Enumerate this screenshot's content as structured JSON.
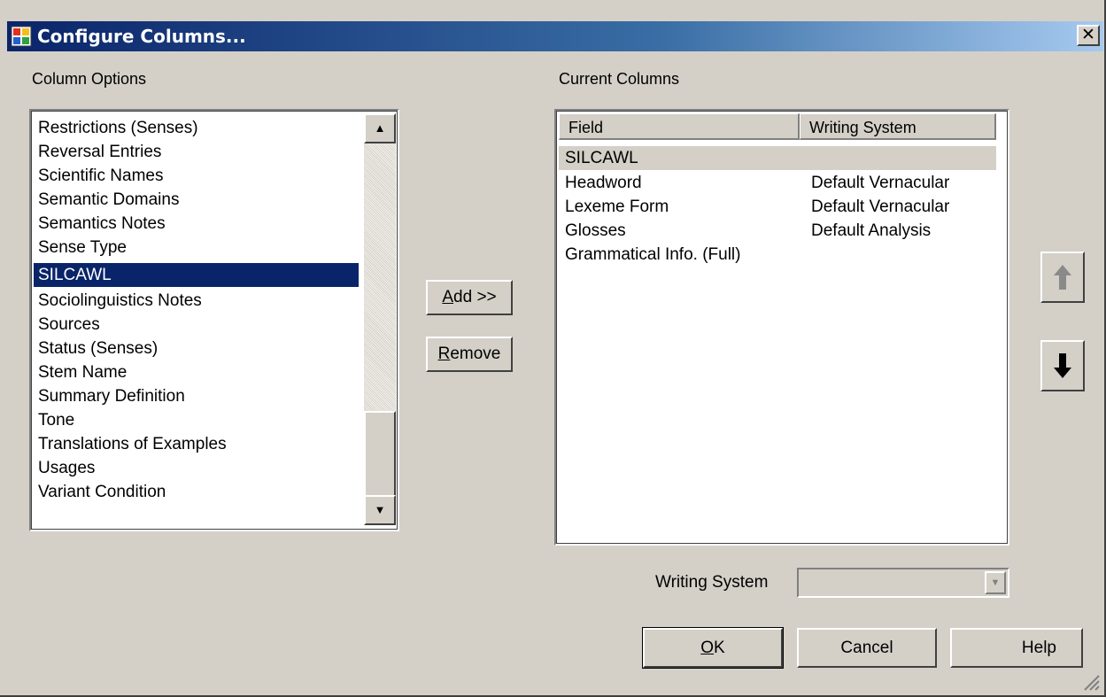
{
  "window": {
    "title": "Configure Columns...",
    "close_glyph": "✕"
  },
  "left": {
    "label": "Column Options",
    "items": [
      "Restrictions (Senses)",
      "Reversal Entries",
      "Scientific Names",
      "Semantic Domains",
      "Semantics Notes",
      "Sense Type",
      "SILCAWL",
      "Sociolinguistics Notes",
      "Sources",
      "Status (Senses)",
      "Stem Name",
      "Summary Definition",
      "Tone",
      "Translations of Examples",
      "Usages",
      "Variant Condition"
    ],
    "selected_item": "SILCAWL"
  },
  "middle": {
    "add": {
      "mnemonic": "A",
      "rest": "dd >>"
    },
    "remove": {
      "mnemonic": "R",
      "rest": "emove"
    }
  },
  "right": {
    "label": "Current Columns",
    "headers": {
      "field": "Field",
      "ws": "Writing System"
    },
    "rows": [
      {
        "field": "SILCAWL",
        "ws": ""
      },
      {
        "field": "Headword",
        "ws": "Default Vernacular"
      },
      {
        "field": "Lexeme Form",
        "ws": "Default Vernacular"
      },
      {
        "field": "Glosses",
        "ws": "Default Analysis"
      },
      {
        "field": "Grammatical Info. (Full)",
        "ws": ""
      }
    ],
    "selected_row": "SILCAWL"
  },
  "move_buttons": {
    "up_icon": "arrow-up-icon",
    "down_icon": "arrow-down-icon"
  },
  "writing_system": {
    "label": "Writing System",
    "value": ""
  },
  "footer": {
    "ok": {
      "mnemonic": "O",
      "rest": "K"
    },
    "cancel": "Cancel",
    "help": "Help"
  },
  "colors": {
    "title_start": "#0a246a",
    "title_end": "#a6caf0",
    "selection": "#0a246a",
    "face": "#d4d0c8"
  }
}
